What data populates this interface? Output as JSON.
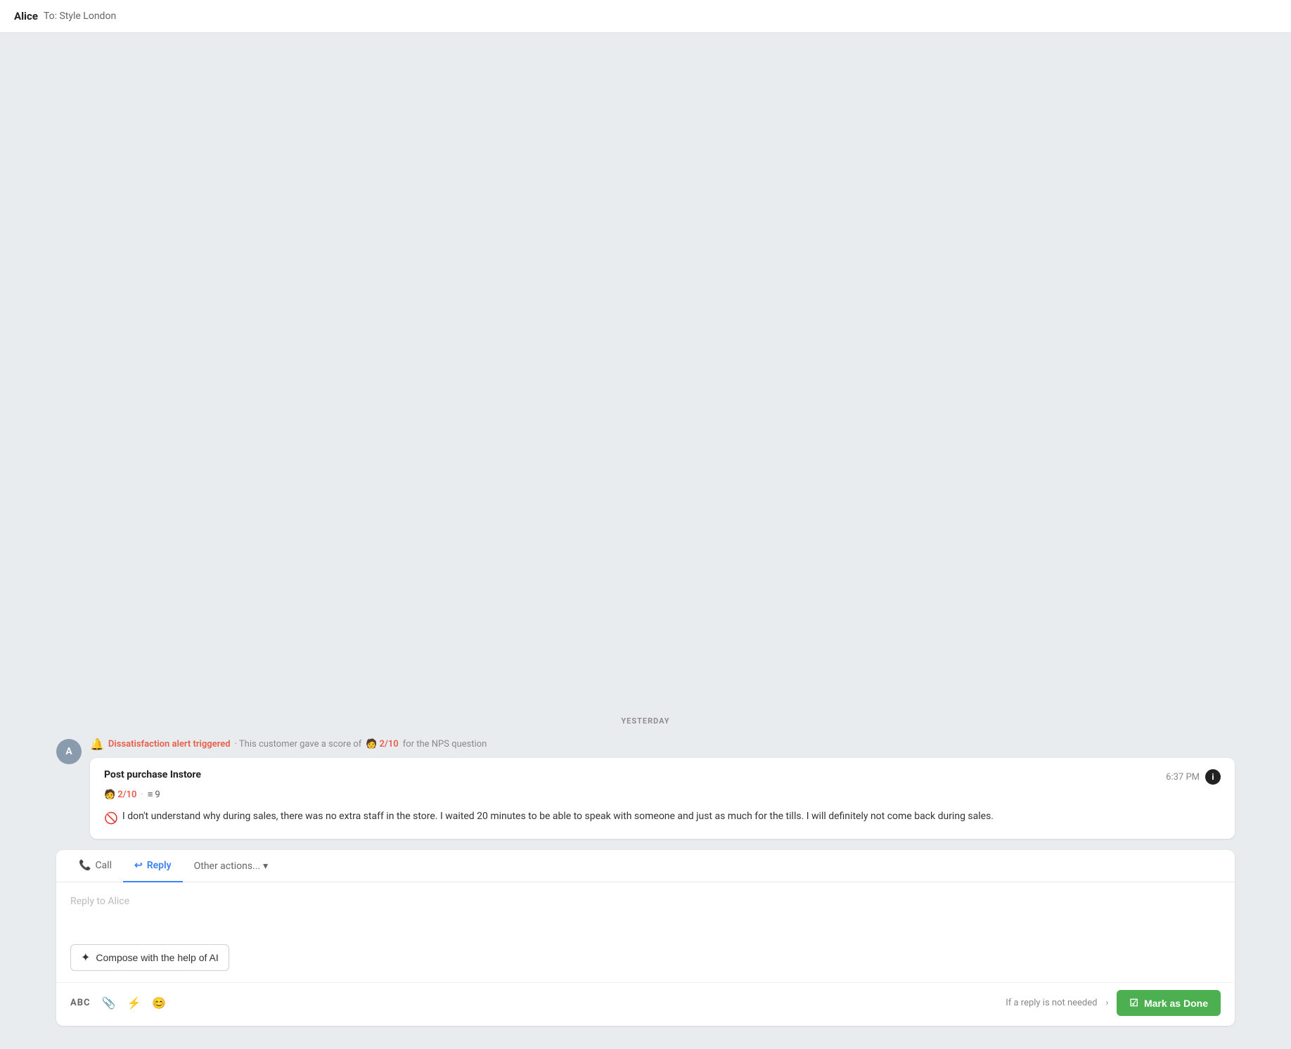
{
  "header": {
    "sender": "Alice",
    "to_label": "To:",
    "to_name": "Style London"
  },
  "date_divider": "YESTERDAY",
  "alert": {
    "bold_text": "Dissatisfaction alert triggered",
    "mid_text": "· This customer gave a score of",
    "score": "2/10",
    "end_text": "for the NPS question"
  },
  "message_card": {
    "title": "Post purchase Instore",
    "time": "6:37 PM",
    "nps_score": "2/10",
    "layers_score": "9",
    "body": "I don't understand why during sales, there was no extra staff in the store. I waited 20 minutes to be able to speak with someone and just as much for the tills. I will definitely not come back during sales."
  },
  "reply_panel": {
    "tabs": [
      {
        "label": "Call",
        "active": false,
        "icon": "📞"
      },
      {
        "label": "Reply",
        "active": true,
        "icon": "↩"
      },
      {
        "label": "Other actions...",
        "active": false,
        "icon": "▾"
      }
    ],
    "placeholder": "Reply to Alice",
    "ai_compose_label": "Compose with the help of AI",
    "toolbar": {
      "abc_label": "ABC",
      "not_needed_text": "If a reply is not needed",
      "mark_done_label": "Mark as Done"
    }
  },
  "avatar_letter": "A"
}
